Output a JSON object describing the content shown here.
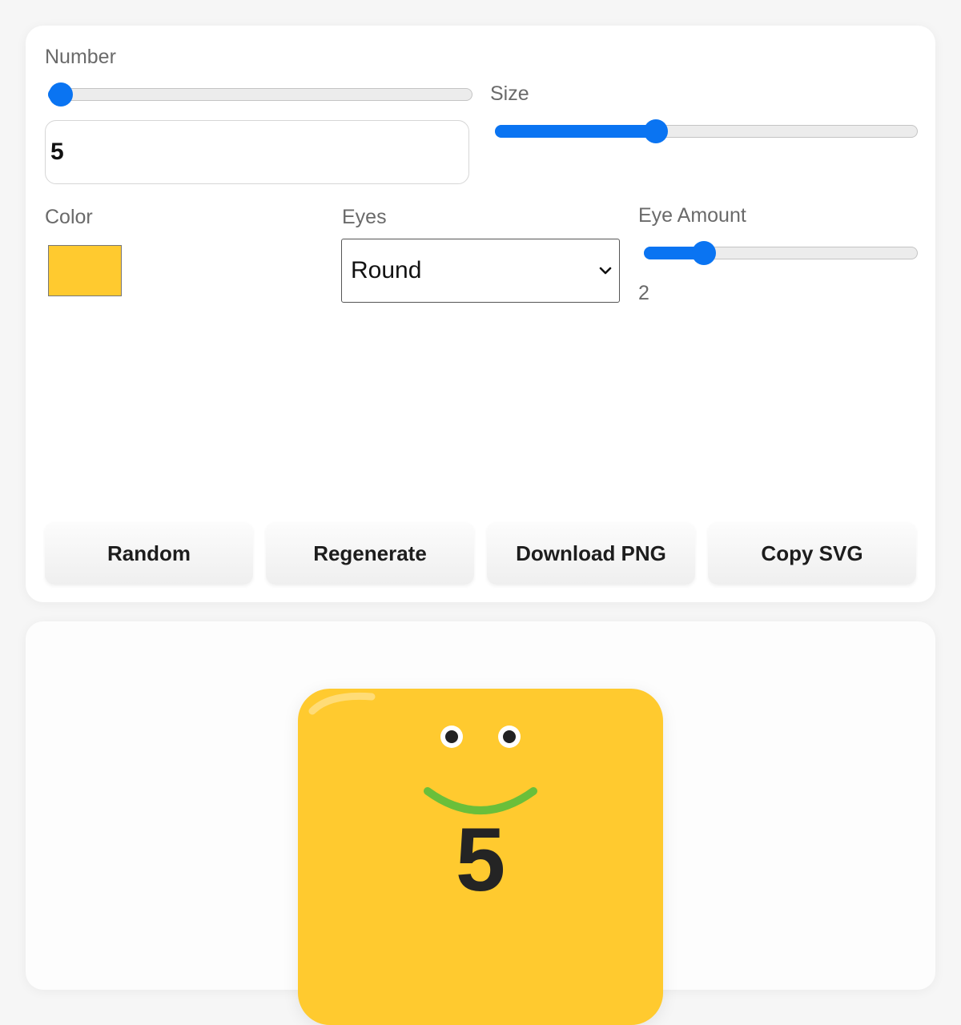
{
  "controls": {
    "number_label": "Number",
    "number_value": "5",
    "number_slider_fraction": 0.03,
    "size_label": "Size",
    "size_slider_fraction": 0.38,
    "color_label": "Color",
    "color_value": "#ffca2f",
    "eyes_label": "Eyes",
    "eyes_selected": "Round",
    "eye_amount_label": "Eye Amount",
    "eye_amount_value": "2",
    "eye_amount_fraction": 0.22
  },
  "buttons": {
    "random": "Random",
    "regenerate": "Regenerate",
    "download": "Download PNG",
    "copy": "Copy SVG"
  },
  "preview": {
    "number": "5",
    "body_color": "#ffca2f",
    "mouth_color": "#6abf3a",
    "eye_color": "#222222"
  },
  "accent_color": "#0a74f2"
}
